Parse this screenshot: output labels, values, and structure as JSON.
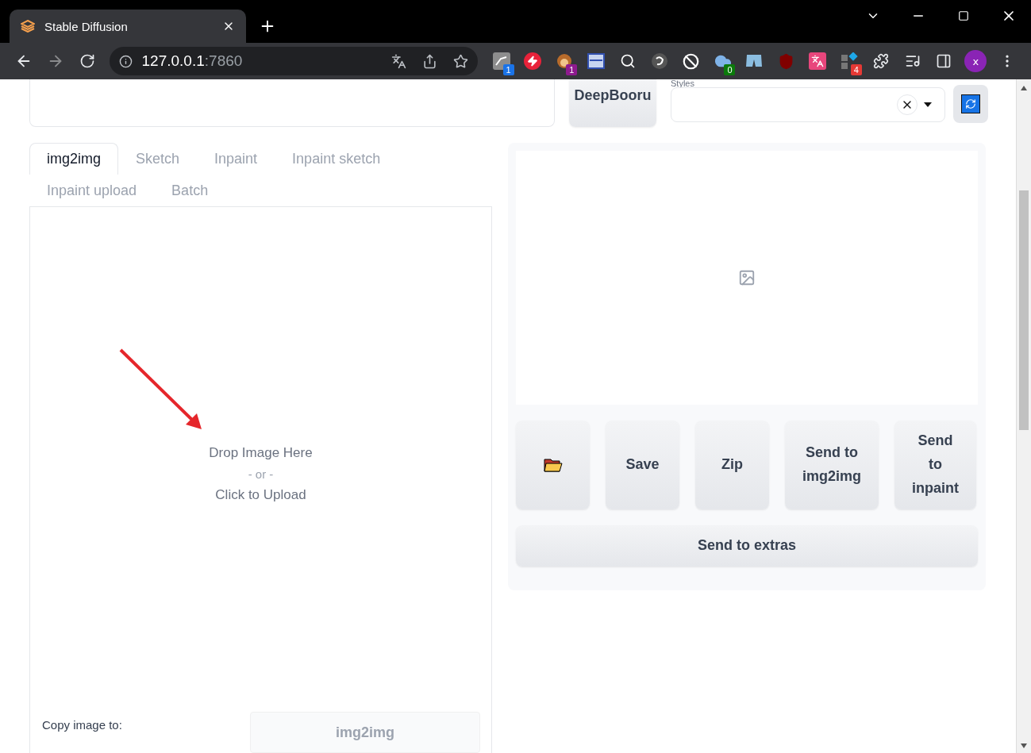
{
  "browser": {
    "tab_title": "Stable Diffusion",
    "url_host": "127.0.0.1",
    "url_port": ":7860",
    "extensions": [
      {
        "kind": "translate-en",
        "badge": "1",
        "color": "#1a73e8"
      },
      {
        "kind": "bolt"
      },
      {
        "kind": "monkey",
        "badge": "1",
        "color": "#8e1a8e"
      },
      {
        "kind": "window"
      },
      {
        "kind": "magnifier"
      },
      {
        "kind": "cat"
      },
      {
        "kind": "block"
      },
      {
        "kind": "cloud",
        "badge": "0",
        "color": "#0b7a0b"
      },
      {
        "kind": "shorts"
      },
      {
        "kind": "shield"
      },
      {
        "kind": "translate"
      },
      {
        "kind": "grid",
        "badge": "4",
        "color": "#e53935"
      }
    ],
    "profile": "x"
  },
  "top": {
    "deepbooru_button": "DeepBooru",
    "styles_label": "Styles"
  },
  "tabs": [
    {
      "label": "img2img",
      "selected": true
    },
    {
      "label": "Sketch",
      "selected": false
    },
    {
      "label": "Inpaint",
      "selected": false
    },
    {
      "label": "Inpaint sketch",
      "selected": false
    },
    {
      "label": "Inpaint upload",
      "selected": false
    },
    {
      "label": "Batch",
      "selected": false
    }
  ],
  "upload": {
    "drop": "Drop Image Here",
    "or": "- or -",
    "click": "Click to Upload",
    "copy_label": "Copy image to:",
    "copy_button": "img2img"
  },
  "actions": [
    {
      "kind": "folder"
    },
    {
      "kind": "text",
      "label": "Save"
    },
    {
      "kind": "text",
      "label": "Zip"
    },
    {
      "kind": "text",
      "label": "Send to img2img"
    },
    {
      "kind": "narrow",
      "label": "Send to inpaint"
    }
  ],
  "extras_button": "Send to extras"
}
